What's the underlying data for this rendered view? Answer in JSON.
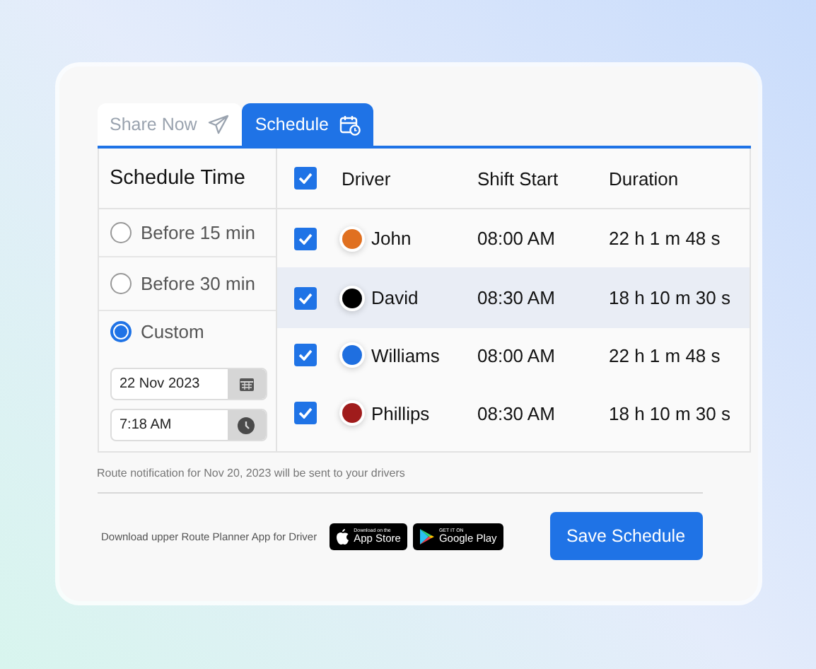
{
  "tabs": [
    {
      "label": "Share Now",
      "selected": false
    },
    {
      "label": "Schedule",
      "selected": true
    }
  ],
  "schedule_time": {
    "title": "Schedule Time",
    "options": [
      {
        "label": "Before 15 min",
        "selected": false
      },
      {
        "label": "Before 30 min",
        "selected": false
      },
      {
        "label": "Custom",
        "selected": true
      }
    ],
    "date": "22 Nov 2023",
    "time": "7:18 AM"
  },
  "table": {
    "all_checked": true,
    "columns": [
      "Driver",
      "Shift Start",
      "Duration"
    ],
    "rows": [
      {
        "checked": true,
        "color": "#e07020",
        "driver": "John",
        "shift_start": "08:00 AM",
        "duration": "22 h 1 m 48 s",
        "selected": false
      },
      {
        "checked": true,
        "color": "#000000",
        "driver": "David",
        "shift_start": "08:30 AM",
        "duration": "18 h 10 m 30 s",
        "selected": true
      },
      {
        "checked": true,
        "color": "#1f6fe0",
        "driver": "Williams",
        "shift_start": "08:00 AM",
        "duration": "22 h 1 m 48 s",
        "selected": false
      },
      {
        "checked": true,
        "color": "#a01c1c",
        "driver": "Phillips",
        "shift_start": "08:30 AM",
        "duration": "18 h 10 m 30 s",
        "selected": false
      }
    ]
  },
  "note": "Route notification for Nov 20, 2023 will be sent to your drivers",
  "download_text": "Download upper Route Planner App for Driver",
  "stores": [
    {
      "kind": "apple",
      "small": "Download on the",
      "big": "App Store"
    },
    {
      "kind": "google",
      "small": "GET IT ON",
      "big": "Google Play"
    }
  ],
  "save_button": "Save Schedule"
}
